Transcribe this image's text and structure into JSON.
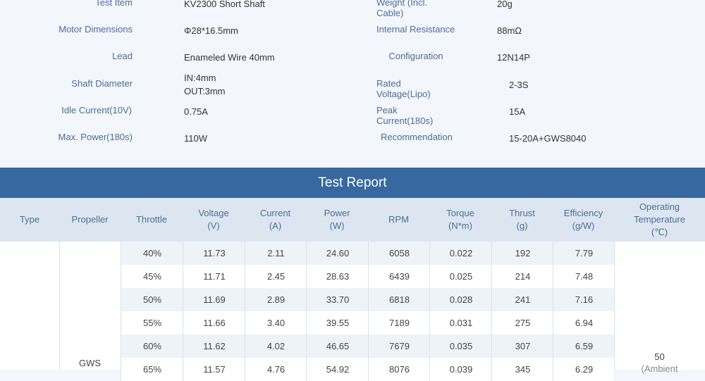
{
  "specs": {
    "rows": [
      {
        "l1": "Test Item",
        "v1": "KV2300 Short Shaft",
        "l2": "Weight (Incl. Cable)",
        "v2": "20g"
      },
      {
        "l1": "Motor Dimensions",
        "v1": "Φ28*16.5mm",
        "l2": "Internal Resistance",
        "v2": "88mΩ"
      },
      {
        "l1": "Lead",
        "v1": "Enameled Wire 40mm",
        "l2": "Configuration",
        "v2": "12N14P"
      },
      {
        "l1": "Shaft Diameter",
        "v1": "IN:4mm\nOUT:3mm",
        "l2": "Rated Voltage(Lipo)",
        "v2": "2-3S"
      },
      {
        "l1": "Idle Current(10V)",
        "v1": "0.75A",
        "l2": "Peak Current(180s)",
        "v2": "15A"
      },
      {
        "l1": "Max. Power(180s)",
        "v1": "110W",
        "l2": "Recommendation",
        "v2": "15-20A+GWS8040"
      }
    ]
  },
  "report": {
    "title": "Test Report",
    "headers": [
      "Type",
      "Propeller",
      "Throttle",
      "Voltage\n(V)",
      "Current\n(A)",
      "Power\n(W)",
      "RPM",
      "Torque\n(N*m)",
      "Thrust\n(g)",
      "Efficiency\n(g/W)",
      "Operating\nTemperature\n(℃)"
    ],
    "propeller": "GWS",
    "temperature": "50",
    "temperature_note": "(Ambient",
    "rows": [
      [
        "40%",
        "11.73",
        "2.11",
        "24.60",
        "6058",
        "0.022",
        "192",
        "7.79"
      ],
      [
        "45%",
        "11.71",
        "2.45",
        "28.63",
        "6439",
        "0.025",
        "214",
        "7.48"
      ],
      [
        "50%",
        "11.69",
        "2.89",
        "33.70",
        "6818",
        "0.028",
        "241",
        "7.16"
      ],
      [
        "55%",
        "11.66",
        "3.40",
        "39.55",
        "7189",
        "0.031",
        "275",
        "6.94"
      ],
      [
        "60%",
        "11.62",
        "4.02",
        "46.65",
        "7679",
        "0.035",
        "307",
        "6.59"
      ],
      [
        "65%",
        "11.57",
        "4.76",
        "54.92",
        "8076",
        "0.039",
        "345",
        "6.29"
      ]
    ]
  }
}
